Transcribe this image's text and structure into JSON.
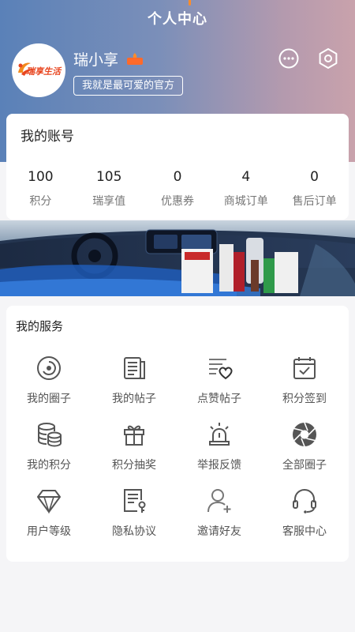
{
  "header": {
    "title": "个人中心",
    "username": "瑞小享",
    "signature": "我就是最可爱的官方",
    "logo_text": "瑞享生活"
  },
  "account": {
    "title": "我的账号",
    "stats": [
      {
        "value": "100",
        "label": "积分"
      },
      {
        "value": "105",
        "label": "瑞享值"
      },
      {
        "value": "0",
        "label": "优惠券"
      },
      {
        "value": "4",
        "label": "商城订单"
      },
      {
        "value": "0",
        "label": "售后订单"
      }
    ]
  },
  "services": {
    "title": "我的服务",
    "items": [
      {
        "label": "我的圈子",
        "icon": "circle-icon"
      },
      {
        "label": "我的帖子",
        "icon": "posts-icon"
      },
      {
        "label": "点赞帖子",
        "icon": "like-list-icon"
      },
      {
        "label": "积分签到",
        "icon": "calendar-check-icon"
      },
      {
        "label": "我的积分",
        "icon": "coins-icon"
      },
      {
        "label": "积分抽奖",
        "icon": "gift-icon"
      },
      {
        "label": "举报反馈",
        "icon": "alarm-icon"
      },
      {
        "label": "全部圈子",
        "icon": "aperture-icon"
      },
      {
        "label": "用户等级",
        "icon": "diamond-icon"
      },
      {
        "label": "隐私协议",
        "icon": "document-key-icon"
      },
      {
        "label": "邀请好友",
        "icon": "add-user-icon"
      },
      {
        "label": "客服中心",
        "icon": "headset-icon"
      }
    ]
  },
  "colors": {
    "header_gradient_start": "#5a81b8",
    "header_gradient_end": "#c9a2ac",
    "accent_orange": "#ff8c2a",
    "icon_gray": "#555555"
  }
}
